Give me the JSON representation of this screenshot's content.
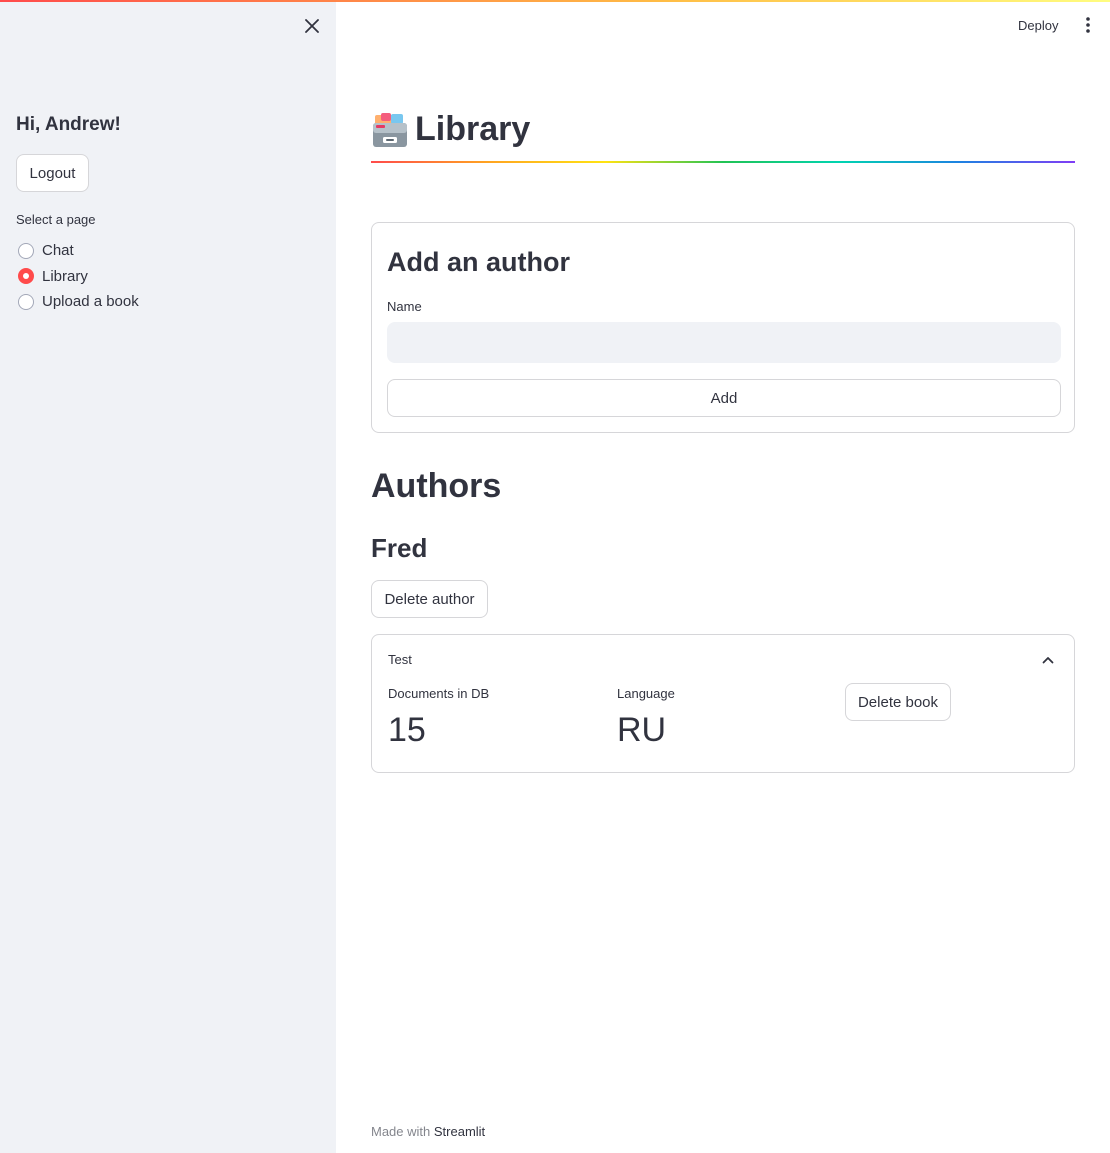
{
  "header": {
    "deploy_label": "Deploy"
  },
  "sidebar": {
    "greeting": "Hi, Andrew!",
    "logout_label": "Logout",
    "page_select_label": "Select a page",
    "pages": [
      {
        "label": "Chat",
        "selected": false
      },
      {
        "label": "Library",
        "selected": true
      },
      {
        "label": "Upload a book",
        "selected": false
      }
    ]
  },
  "main": {
    "title": "Library",
    "title_icon": "card-file-box-icon",
    "add_author_form": {
      "heading": "Add an author",
      "name_label": "Name",
      "name_value": "",
      "name_placeholder": "",
      "add_label": "Add"
    },
    "authors_heading": "Authors",
    "authors": [
      {
        "name": "Fred",
        "delete_label": "Delete author",
        "books": [
          {
            "title": "Test",
            "expanded": true,
            "documents_label": "Documents in DB",
            "documents_value": "15",
            "language_label": "Language",
            "language_value": "RU",
            "delete_label": "Delete book"
          }
        ]
      }
    ]
  },
  "footer": {
    "made_with": "Made with",
    "brand": "Streamlit"
  },
  "colors": {
    "accent": "#ff4b4b",
    "sidebar_bg": "#f0f2f6",
    "text": "#31333f"
  }
}
